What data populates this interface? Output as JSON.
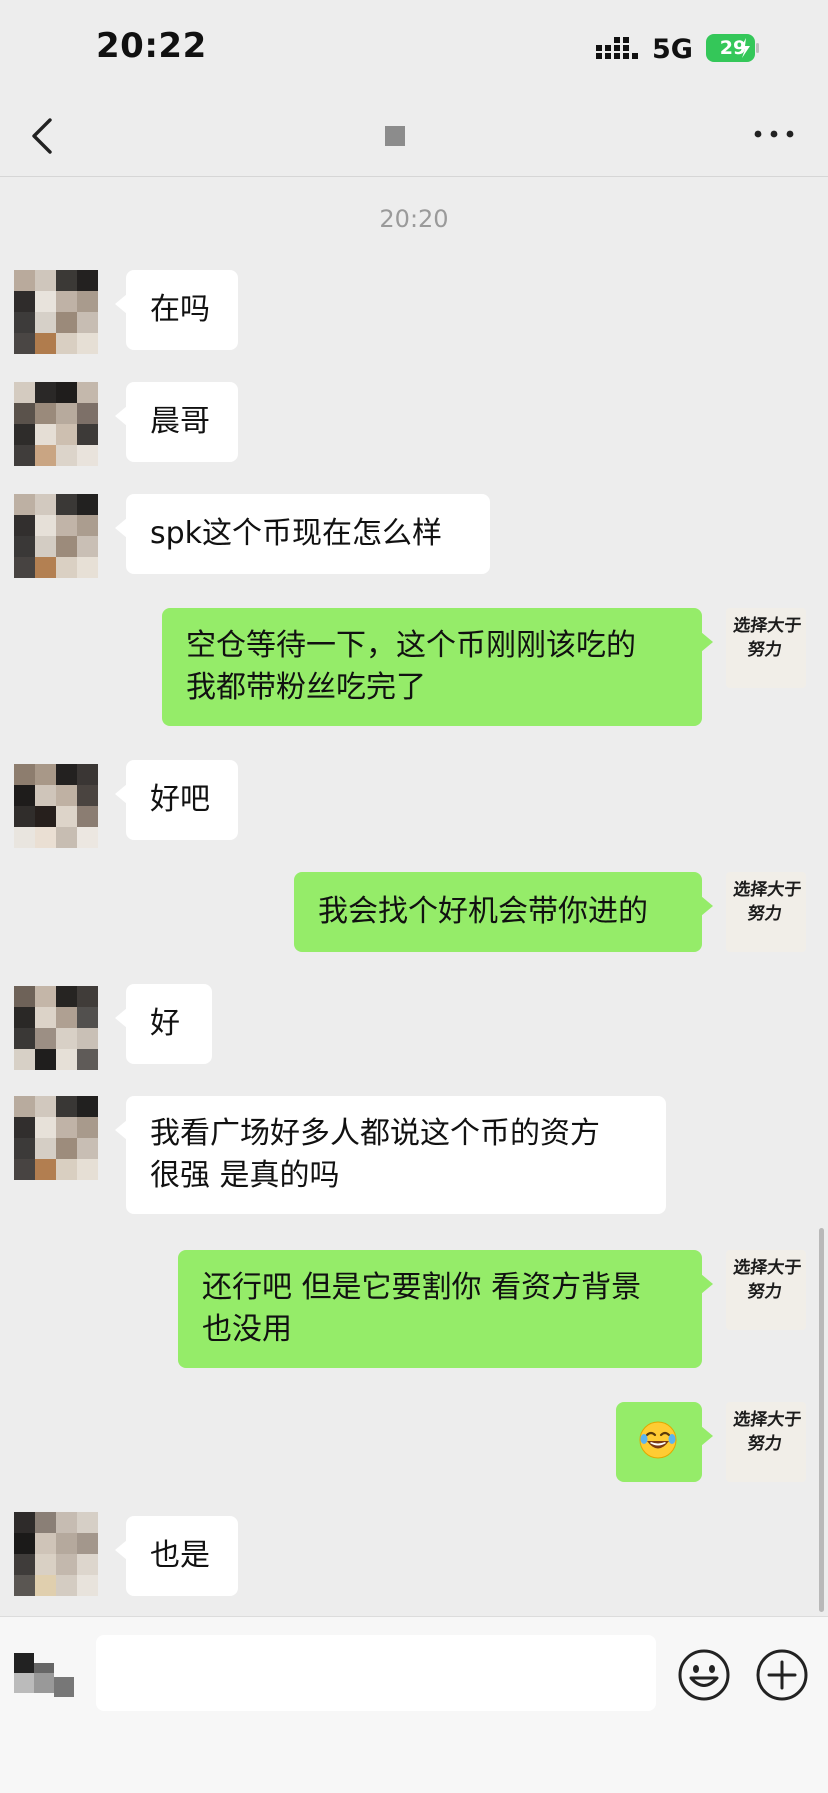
{
  "status_bar": {
    "time": "20:22",
    "network": "5G",
    "battery": "29"
  },
  "nav": {
    "title": "■"
  },
  "chat": {
    "timestamp": "20:20",
    "messages": [
      {
        "from": "contact",
        "text": "在吗"
      },
      {
        "from": "contact",
        "text": "晨哥"
      },
      {
        "from": "contact",
        "text": "spk这个币现在怎么样"
      },
      {
        "from": "me",
        "lines": [
          "空仓等待一下，这个币刚刚该吃的",
          "我都带粉丝吃完了"
        ]
      },
      {
        "from": "contact",
        "text": "好吧"
      },
      {
        "from": "me",
        "text": "我会找个好机会带你进的"
      },
      {
        "from": "contact",
        "text": "好"
      },
      {
        "from": "contact",
        "lines": [
          "我看广场好多人都说这个币的资方",
          "很强 是真的吗"
        ]
      },
      {
        "from": "me",
        "lines": [
          "还行吧 但是它要割你 看资方背景",
          "也没用"
        ]
      },
      {
        "from": "me",
        "emoji": "laughing-with-tears-emoji"
      },
      {
        "from": "contact",
        "text": "也是"
      }
    ]
  },
  "self_avatar": {
    "line1": "选择大于",
    "line2": "努力"
  },
  "input": {
    "value": "",
    "placeholder": ""
  },
  "colors": {
    "background": "#ededed",
    "outgoing_bubble": "#95ec69",
    "incoming_bubble": "#ffffff",
    "battery": "#34c759"
  }
}
